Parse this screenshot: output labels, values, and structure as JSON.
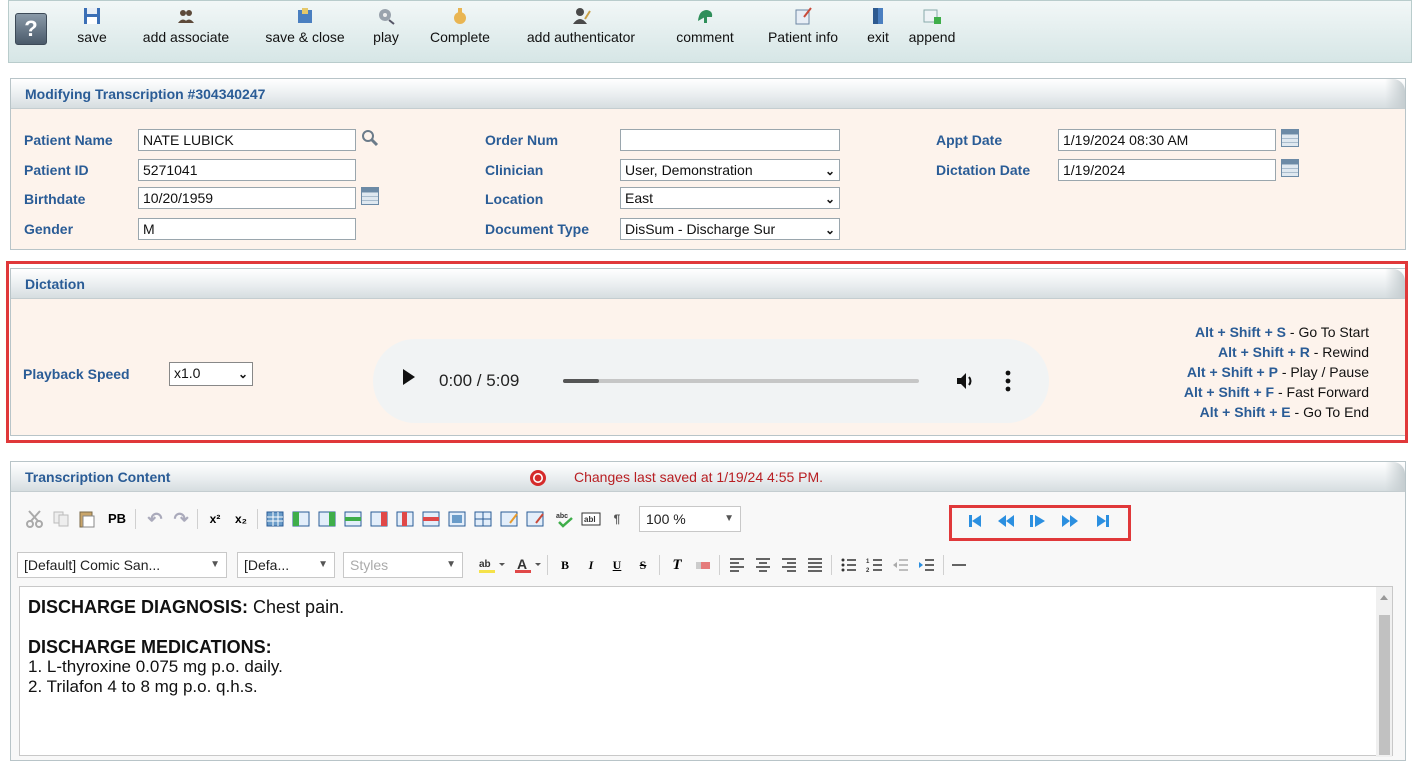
{
  "toolbar": {
    "help_label": "?",
    "buttons": [
      {
        "label": "save",
        "icon": "floppy-disk-icon"
      },
      {
        "label": "add associate",
        "icon": "people-icon"
      },
      {
        "label": "save & close",
        "icon": "save-close-icon"
      },
      {
        "label": "play",
        "icon": "play-reel-icon"
      },
      {
        "label": "Complete",
        "icon": "complete-hand-icon"
      },
      {
        "label": "add authenticator",
        "icon": "user-pen-icon"
      },
      {
        "label": "comment",
        "icon": "comment-icon"
      },
      {
        "label": "Patient info",
        "icon": "notepad-icon"
      },
      {
        "label": "exit",
        "icon": "door-icon"
      },
      {
        "label": "append",
        "icon": "add-page-icon"
      }
    ]
  },
  "header_panel": {
    "title": "Modifying Transcription #304340247",
    "fields": {
      "patient_name_label": "Patient Name",
      "patient_name": "NATE LUBICK",
      "patient_id_label": "Patient ID",
      "patient_id": "5271041",
      "birthdate_label": "Birthdate",
      "birthdate": "10/20/1959",
      "gender_label": "Gender",
      "gender": "M",
      "order_num_label": "Order Num",
      "order_num": "",
      "clinician_label": "Clinician",
      "clinician": "User, Demonstration",
      "location_label": "Location",
      "location": "East",
      "document_type_label": "Document Type",
      "document_type": "DisSum - Discharge Sur",
      "appt_date_label": "Appt Date",
      "appt_date": "1/19/2024 08:30 AM",
      "dictation_date_label": "Dictation Date",
      "dictation_date": "1/19/2024"
    }
  },
  "dictation": {
    "title": "Dictation",
    "playback_speed_label": "Playback Speed",
    "playback_speed": "x1.0",
    "audio_time": "0:00 / 5:09",
    "audio_progress": 0.0,
    "shortcuts": [
      {
        "keys": "Alt + Shift + S",
        "sep": " - ",
        "action": "Go To Start"
      },
      {
        "keys": "Alt + Shift + R",
        "sep": " - ",
        "action": "Rewind"
      },
      {
        "keys": "Alt + Shift + P",
        "sep": " - ",
        "action": "Play / Pause"
      },
      {
        "keys": "Alt + Shift + F",
        "sep": " - ",
        "action": "Fast Forward"
      },
      {
        "keys": "Alt + Shift + E",
        "sep": " - ",
        "action": "Go To End"
      }
    ]
  },
  "content": {
    "title": "Transcription Content",
    "saved_status": "Changes last saved at 1/19/24 4:55 PM.",
    "zoom": "100 %",
    "pb_label": "PB",
    "font_name": "[Default] Comic San...",
    "font_size": "[Defa...",
    "styles": "Styles",
    "doc": {
      "dx_heading": "DISCHARGE DIAGNOSIS:",
      "dx_text": " Chest pain.",
      "meds_heading": "DISCHARGE MEDICATIONS:",
      "meds": [
        "1. L-thyroxine 0.075 mg p.o. daily.",
        "2. Trilafon 4 to 8 mg p.o. q.h.s."
      ]
    }
  },
  "colors": {
    "label_blue": "#2a5c96",
    "highlight_red": "#e0383a",
    "panel_bg": "#fdf3ec",
    "saved_red": "#b81e22"
  }
}
